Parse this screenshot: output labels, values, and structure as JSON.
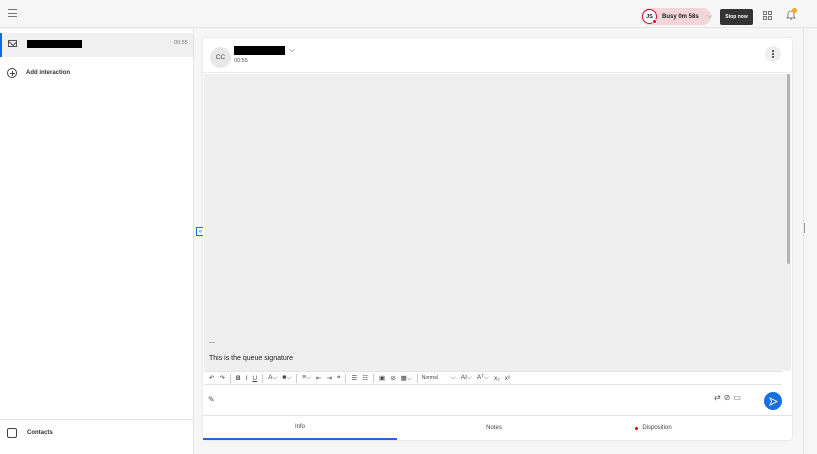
{
  "topbar": {
    "menu_icon": "hamburger-icon",
    "status": {
      "initials": "JS",
      "label": "Busy",
      "duration": "0m 58s",
      "color": "#f2d6da",
      "indicator": "#d0021b"
    },
    "stop_label": "Stop now",
    "layout_icon": "layout-grid-icon",
    "bell_icon": "bell-icon",
    "bell_badge_color": "#f5a623"
  },
  "sidebar": {
    "interaction": {
      "icon": "mail-icon",
      "time": "00:55"
    },
    "add_label": "Add interaction",
    "contacts_label": "Contacts",
    "collapse_glyph": "«"
  },
  "conversation": {
    "avatar": "CC",
    "time": "00:55",
    "signature_separator": "---",
    "signature": "This is the queue signature",
    "toolbar": {
      "style_select": "Normal"
    },
    "tabs": {
      "info": "Info",
      "notes": "Notes",
      "disposition": "Disposition"
    }
  },
  "accent_color": "#2962d9",
  "send_color": "#1a6fe0"
}
